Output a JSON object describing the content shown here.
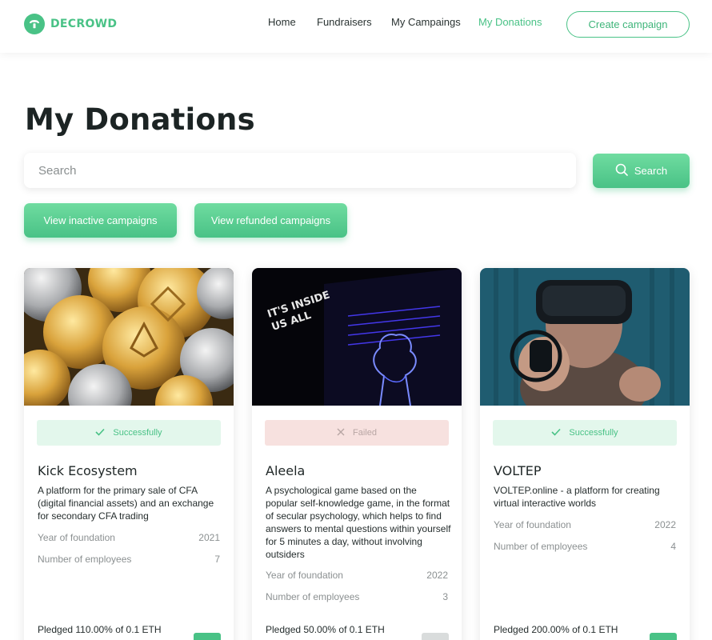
{
  "header": {
    "logo_text": "DECROWD",
    "nav": [
      {
        "label": "Home",
        "active": false
      },
      {
        "label": "Fundraisers",
        "active": false
      },
      {
        "label": "My Campaings",
        "active": false
      },
      {
        "label": "My Donations",
        "active": true
      }
    ],
    "create_label": "Create campaign"
  },
  "page_title": "My Donations",
  "search": {
    "placeholder": "Search",
    "value": "",
    "button_label": "Search"
  },
  "filters": {
    "inactive_label": "View inactive campaigns",
    "refunded_label": "View refunded campaigns"
  },
  "colors": {
    "accent": "#49c286",
    "success_bg": "#e3f7ec",
    "failed_bg": "#f7e1df"
  },
  "cards": [
    {
      "image": "crypto-coins-photo",
      "status": "Successfully",
      "status_icon": "check-icon",
      "title": "Kick Ecosystem",
      "description": "A platform for the primary sale of CFA (digital financial assets) and an exchange for secondary CFA trading",
      "year_label": "Year of foundation",
      "year_value": "2021",
      "employees_label": "Number of employees",
      "employees_value": "7",
      "pledged": "Pledged 110.00% of 0.1 ETH"
    },
    {
      "image": "neon-exhibit-photo",
      "status": "Failed",
      "status_icon": "x-icon",
      "title": "Aleela",
      "description": "A psychological game based on the popular self-knowledge game, in the format of secular psychology, which helps to find answers to mental questions within yourself for 5 minutes a day, without involving outsiders",
      "year_label": "Year of foundation",
      "year_value": "2022",
      "employees_label": "Number of employees",
      "employees_value": "3",
      "pledged": "Pledged 50.00% of 0.1 ETH"
    },
    {
      "image": "vr-headset-photo",
      "status": "Successfully",
      "status_icon": "check-icon",
      "title": "VOLTEP",
      "description": "VOLTEP.online - a platform for creating virtual interactive worlds",
      "year_label": "Year of foundation",
      "year_value": "2022",
      "employees_label": "Number of employees",
      "employees_value": "4",
      "pledged": "Pledged 200.00% of 0.1 ETH"
    }
  ]
}
